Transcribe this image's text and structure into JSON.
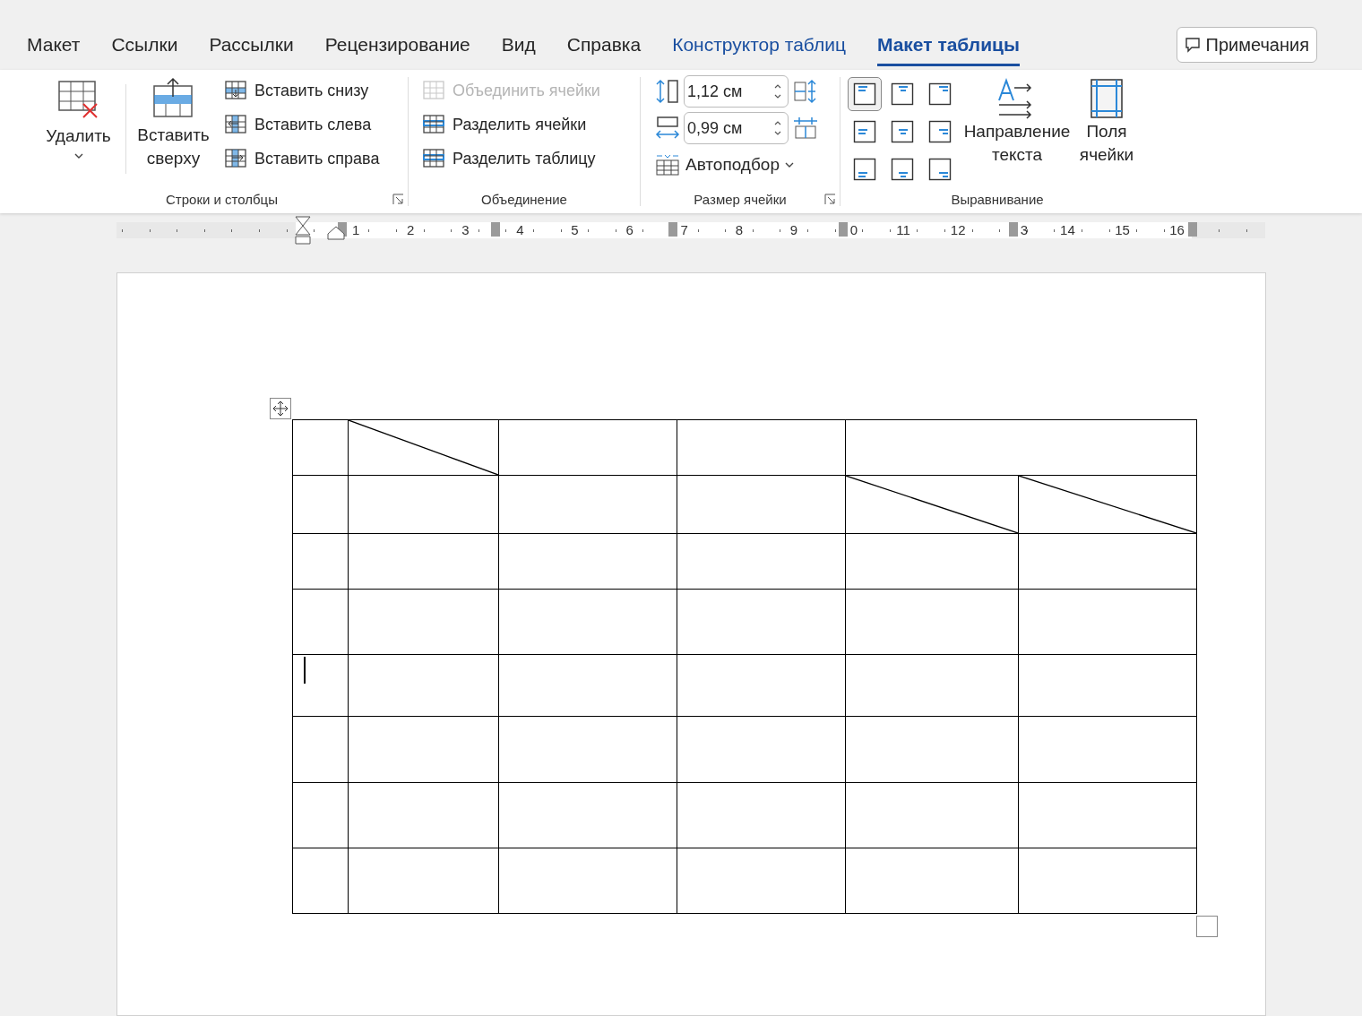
{
  "tabs": [
    {
      "label": "Макет",
      "kind": "normal",
      "selected": false
    },
    {
      "label": "Ссылки",
      "kind": "normal",
      "selected": false
    },
    {
      "label": "Рассылки",
      "kind": "normal",
      "selected": false
    },
    {
      "label": "Рецензирование",
      "kind": "normal",
      "selected": false
    },
    {
      "label": "Вид",
      "kind": "normal",
      "selected": false
    },
    {
      "label": "Справка",
      "kind": "normal",
      "selected": false
    },
    {
      "label": "Конструктор таблиц",
      "kind": "contextual",
      "selected": false
    },
    {
      "label": "Макет таблицы",
      "kind": "contextual",
      "selected": true
    }
  ],
  "notes_button": {
    "label": "Примечания"
  },
  "ribbon": {
    "rows_columns": {
      "label": "Строки и столбцы",
      "delete": {
        "label": "Удалить"
      },
      "insert_above": {
        "label": "Вставить сверху"
      },
      "inserts": [
        {
          "label": "Вставить снизу"
        },
        {
          "label": "Вставить слева"
        },
        {
          "label": "Вставить справа"
        }
      ]
    },
    "merge": {
      "label": "Объединение",
      "buttons": [
        {
          "label": "Объединить ячейки",
          "disabled": true
        },
        {
          "label": "Разделить ячейки",
          "disabled": false
        },
        {
          "label": "Разделить таблицу",
          "disabled": false
        }
      ]
    },
    "cell_size": {
      "label": "Размер ячейки",
      "height": {
        "value": "1,12 см"
      },
      "width": {
        "value": "0,99 см"
      },
      "autofit": {
        "label": "Автоподбор"
      }
    },
    "alignment": {
      "label": "Выравнивание",
      "cells": [
        {
          "selected": true
        },
        {
          "selected": false
        },
        {
          "selected": false
        },
        {
          "selected": false
        },
        {
          "selected": false
        },
        {
          "selected": false
        },
        {
          "selected": false
        },
        {
          "selected": false
        },
        {
          "selected": false
        }
      ],
      "text_direction": {
        "label": "Направление текста"
      },
      "cell_margins": {
        "label": "Поля ячейки"
      }
    }
  },
  "ruler": {
    "labels": [
      "1",
      "2",
      "3",
      "4",
      "5",
      "6",
      "7",
      "8",
      "9",
      "0",
      "11",
      "12",
      "3",
      "14",
      "15",
      "16"
    ]
  },
  "table": {
    "rows": [
      {
        "cells": [
          {
            "kind": "normal"
          },
          {
            "kind": "diagonal"
          },
          {
            "kind": "normal"
          },
          {
            "kind": "normal"
          },
          {
            "kind": "merged"
          }
        ]
      },
      {
        "cells": [
          {
            "kind": "normal"
          },
          {
            "kind": "normal"
          },
          {
            "kind": "normal"
          },
          {
            "kind": "normal"
          },
          {
            "kind": "diagonal"
          },
          {
            "kind": "diagonal"
          }
        ]
      },
      {
        "cells": [
          {
            "kind": "normal"
          },
          {
            "kind": "normal"
          },
          {
            "kind": "normal"
          },
          {
            "kind": "normal"
          },
          {
            "kind": "normal"
          },
          {
            "kind": "normal"
          }
        ]
      },
      {
        "cells": [
          {
            "kind": "normal"
          },
          {
            "kind": "normal"
          },
          {
            "kind": "normal"
          },
          {
            "kind": "normal"
          },
          {
            "kind": "normal"
          },
          {
            "kind": "normal"
          }
        ]
      },
      {
        "cells": [
          {
            "kind": "cursor"
          },
          {
            "kind": "normal"
          },
          {
            "kind": "normal"
          },
          {
            "kind": "normal"
          },
          {
            "kind": "normal"
          },
          {
            "kind": "normal"
          }
        ]
      },
      {
        "cells": [
          {
            "kind": "normal"
          },
          {
            "kind": "normal"
          },
          {
            "kind": "normal"
          },
          {
            "kind": "normal"
          },
          {
            "kind": "normal"
          },
          {
            "kind": "normal"
          }
        ]
      },
      {
        "cells": [
          {
            "kind": "normal"
          },
          {
            "kind": "normal"
          },
          {
            "kind": "normal"
          },
          {
            "kind": "normal"
          },
          {
            "kind": "normal"
          },
          {
            "kind": "normal"
          }
        ]
      },
      {
        "cells": [
          {
            "kind": "normal"
          },
          {
            "kind": "normal"
          },
          {
            "kind": "normal"
          },
          {
            "kind": "normal"
          },
          {
            "kind": "normal"
          },
          {
            "kind": "normal"
          }
        ]
      }
    ]
  }
}
